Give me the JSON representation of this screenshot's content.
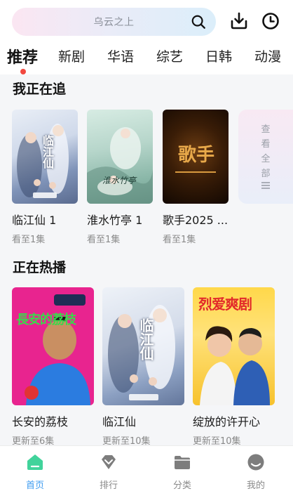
{
  "search": {
    "placeholder": "乌云之上"
  },
  "icons": {
    "search": "search-icon",
    "download": "download-icon",
    "history": "clock-icon"
  },
  "colors": {
    "accent_blue": "#3f9cf0",
    "active_dot": "#f2483f",
    "home_icon_green": "#41d39b"
  },
  "tabs": [
    {
      "label": "推荐",
      "active": true
    },
    {
      "label": "新剧"
    },
    {
      "label": "华语"
    },
    {
      "label": "综艺"
    },
    {
      "label": "日韩"
    },
    {
      "label": "动漫"
    }
  ],
  "watching": {
    "title": "我正在追",
    "items": [
      {
        "title": "临江仙 1",
        "progress": "看至1集",
        "poster_text": "临江仙"
      },
      {
        "title": "淮水竹亭 1",
        "progress": "看至1集",
        "poster_text": "淮水竹亭"
      },
      {
        "title": "歌手2025 ...",
        "progress": "看至1集",
        "poster_text": "歌手"
      }
    ],
    "more_label": "查看全部"
  },
  "hot": {
    "title": "正在热播",
    "items": [
      {
        "title": "长安的荔枝",
        "progress": "更新至6集",
        "poster_text": "長安的荔枝"
      },
      {
        "title": "临江仙",
        "progress": "更新至10集",
        "poster_text": "临江仙"
      },
      {
        "title": "绽放的许开心",
        "progress": "更新至10集",
        "poster_text": "烈爱爽剧"
      }
    ]
  },
  "bottom_nav": [
    {
      "label": "首页",
      "icon": "home-icon",
      "active": true
    },
    {
      "label": "排行",
      "icon": "rank-icon"
    },
    {
      "label": "分类",
      "icon": "folder-icon"
    },
    {
      "label": "我的",
      "icon": "profile-icon"
    }
  ]
}
